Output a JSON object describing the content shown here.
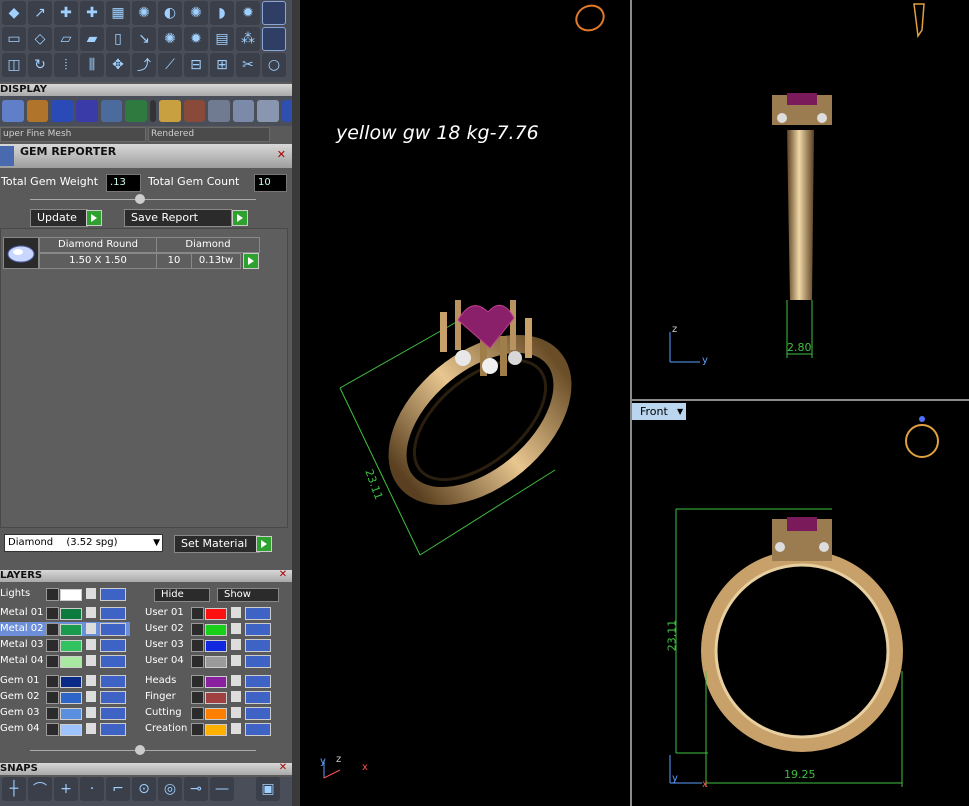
{
  "display": {
    "title": "DISPLAY",
    "mesh": "uper Fine Mesh",
    "render_mode": "Rendered"
  },
  "gem_reporter": {
    "title": "GEM REPORTER",
    "total_weight_label": "Total Gem Weight",
    "total_weight_value": ".13",
    "total_count_label": "Total Gem Count",
    "total_count_value": "10",
    "update_label": "Update",
    "save_label": "Save Report",
    "col1_header": "Diamond Round",
    "col2_header": "Diamond",
    "size": "1.50 X 1.50",
    "count": "10",
    "tw": "0.13tw",
    "material": "Diamond",
    "spg": "(3.52 spg)",
    "set_material_label": "Set Material"
  },
  "layers": {
    "title": "LAYERS",
    "lights": "Lights",
    "hide": "Hide",
    "show": "Show",
    "left": [
      "Metal 01",
      "Metal 02",
      "Metal 03",
      "Metal 04",
      "Gem 01",
      "Gem 02",
      "Gem 03",
      "Gem 04"
    ],
    "left_colors": [
      "#0e7b3e",
      "#1a9a4d",
      "#33c260",
      "#a8e8a0",
      "#0a2a88",
      "#2d65c8",
      "#5a8fe0",
      "#9ec4ff"
    ],
    "right": [
      "User 01",
      "User 02",
      "User 03",
      "User 04",
      "Heads",
      "Finger",
      "Cutting",
      "Creation"
    ],
    "right_colors": [
      "#ff1010",
      "#18d018",
      "#1028e0",
      "#9a9a9a",
      "#8a20a0",
      "#a04040",
      "#ff8000",
      "#ffb000"
    ]
  },
  "snaps": {
    "title": "SNAPS"
  },
  "viewports": {
    "annotation": "yellow gw 18 kg-7.76",
    "front_label": "Front",
    "dim_main": "23.11",
    "dim_side": "2.80",
    "dim_front_h": "23.11",
    "dim_front_w": "19.25",
    "axis_z": "z",
    "axis_y": "y",
    "axis_x": "x"
  },
  "colors": {
    "gold": "#c7a06a",
    "dim": "#3fbf3f",
    "gem": "#8a1f6a"
  }
}
